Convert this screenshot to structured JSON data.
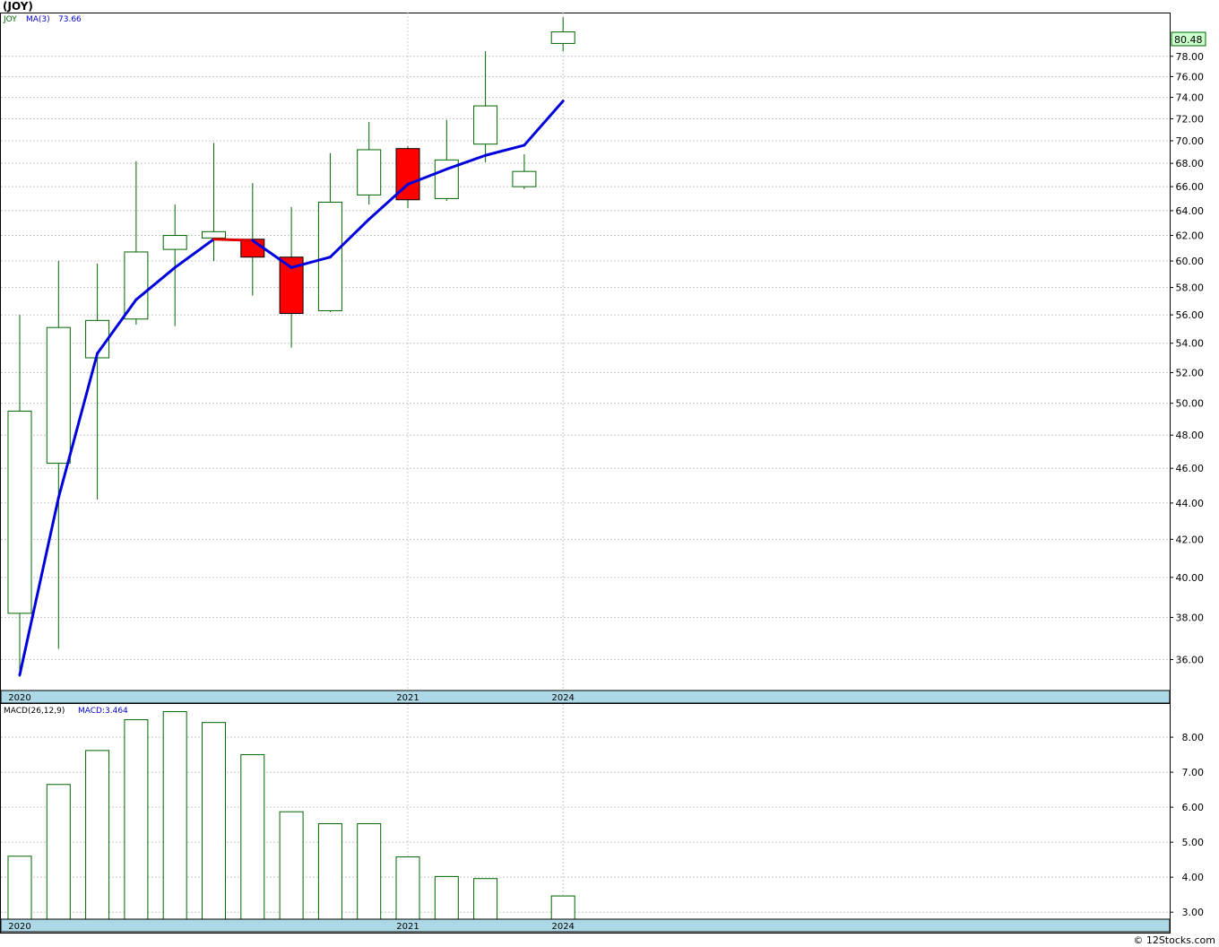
{
  "header": {
    "symbol_title": "(JOY)",
    "copyright": "© 12Stocks.com"
  },
  "price_panel": {
    "legend_symbol": "JOY",
    "legend_ma_label": "MA(3)",
    "legend_ma_value": "73.66",
    "last_price_label": "80.48",
    "x_labels": [
      "2020",
      "2021",
      "2024"
    ]
  },
  "macd_panel": {
    "legend_label": "MACD(26,12,9)",
    "legend_value": "MACD:3.464",
    "x_labels": [
      "2020",
      "2021",
      "2024"
    ]
  },
  "colors": {
    "up_body": "#ffffff",
    "down_body": "#ff0000",
    "wick": "#006400",
    "ma_line": "#0000dd",
    "ma_line_down": "#dd0000",
    "date_band": "#add8e6",
    "last_price_box": "#ccffcc",
    "grid": "#c8c8c8"
  },
  "chart_data": [
    {
      "type": "candlestick",
      "title": "(JOY)",
      "y_scale": "log",
      "ylim": [
        34.6,
        82.5
      ],
      "y_ticks": [
        36,
        38,
        40,
        42,
        44,
        46,
        48,
        50,
        52,
        54,
        56,
        58,
        60,
        62,
        64,
        66,
        68,
        70,
        72,
        74,
        76,
        78
      ],
      "last_price": 80.48,
      "x_labels": [
        {
          "label": "2020",
          "bar": 0
        },
        {
          "label": "2021",
          "bar": 10
        },
        {
          "label": "2024",
          "bar": 14
        }
      ],
      "candles": [
        {
          "open": 38.2,
          "high": 56.0,
          "low": 35.2,
          "close": 49.5,
          "direction": "up"
        },
        {
          "open": 46.3,
          "high": 60.0,
          "low": 36.5,
          "close": 55.1,
          "direction": "up"
        },
        {
          "open": 53.0,
          "high": 59.8,
          "low": 44.2,
          "close": 55.6,
          "direction": "up"
        },
        {
          "open": 55.7,
          "high": 68.2,
          "low": 55.3,
          "close": 60.7,
          "direction": "up"
        },
        {
          "open": 60.9,
          "high": 64.5,
          "low": 55.2,
          "close": 62.0,
          "direction": "up"
        },
        {
          "open": 61.8,
          "high": 69.8,
          "low": 60.0,
          "close": 62.3,
          "direction": "up"
        },
        {
          "open": 61.7,
          "high": 66.3,
          "low": 57.4,
          "close": 60.3,
          "direction": "down"
        },
        {
          "open": 60.3,
          "high": 64.3,
          "low": 53.7,
          "close": 56.1,
          "direction": "down"
        },
        {
          "open": 56.3,
          "high": 68.9,
          "low": 56.2,
          "close": 64.7,
          "direction": "up"
        },
        {
          "open": 65.3,
          "high": 71.7,
          "low": 64.5,
          "close": 69.2,
          "direction": "up"
        },
        {
          "open": 69.3,
          "high": 69.5,
          "low": 64.2,
          "close": 64.9,
          "direction": "down"
        },
        {
          "open": 65.0,
          "high": 71.9,
          "low": 64.8,
          "close": 68.3,
          "direction": "up"
        },
        {
          "open": 69.7,
          "high": 78.5,
          "low": 68.1,
          "close": 73.2,
          "direction": "up"
        },
        {
          "open": 66.0,
          "high": 68.8,
          "low": 65.8,
          "close": 67.3,
          "direction": "up"
        },
        {
          "open": 79.3,
          "high": 82.0,
          "low": 78.5,
          "close": 80.48,
          "direction": "up"
        }
      ],
      "ma_series": {
        "name": "MA(3)",
        "values": [
          35.3,
          44.3,
          53.3,
          57.1,
          59.5,
          61.7,
          61.6,
          59.5,
          60.3,
          63.3,
          66.2,
          67.5,
          68.7,
          69.6,
          73.66
        ],
        "direction": [
          "up",
          "up",
          "up",
          "up",
          "up",
          "up",
          "down",
          "up",
          "up",
          "up",
          "up",
          "up",
          "up",
          "up",
          "up"
        ]
      }
    },
    {
      "type": "bar",
      "title": "MACD(26,12,9)",
      "ylim": [
        2.8,
        8.95
      ],
      "y_ticks": [
        3,
        4,
        5,
        6,
        7,
        8
      ],
      "x_labels": [
        {
          "label": "2020",
          "bar": 0
        },
        {
          "label": "2021",
          "bar": 10
        },
        {
          "label": "2024",
          "bar": 14
        }
      ],
      "bars": [
        {
          "bar": 0,
          "value": 4.6
        },
        {
          "bar": 1,
          "value": 6.65
        },
        {
          "bar": 2,
          "value": 7.62
        },
        {
          "bar": 3,
          "value": 8.5
        },
        {
          "bar": 4,
          "value": 8.73
        },
        {
          "bar": 5,
          "value": 8.42
        },
        {
          "bar": 6,
          "value": 7.5
        },
        {
          "bar": 7,
          "value": 5.87
        },
        {
          "bar": 8,
          "value": 5.53
        },
        {
          "bar": 9,
          "value": 5.53
        },
        {
          "bar": 10,
          "value": 4.58
        },
        {
          "bar": 11,
          "value": 4.02
        },
        {
          "bar": 12,
          "value": 3.96
        },
        {
          "bar": 14,
          "value": 3.464
        }
      ]
    }
  ]
}
